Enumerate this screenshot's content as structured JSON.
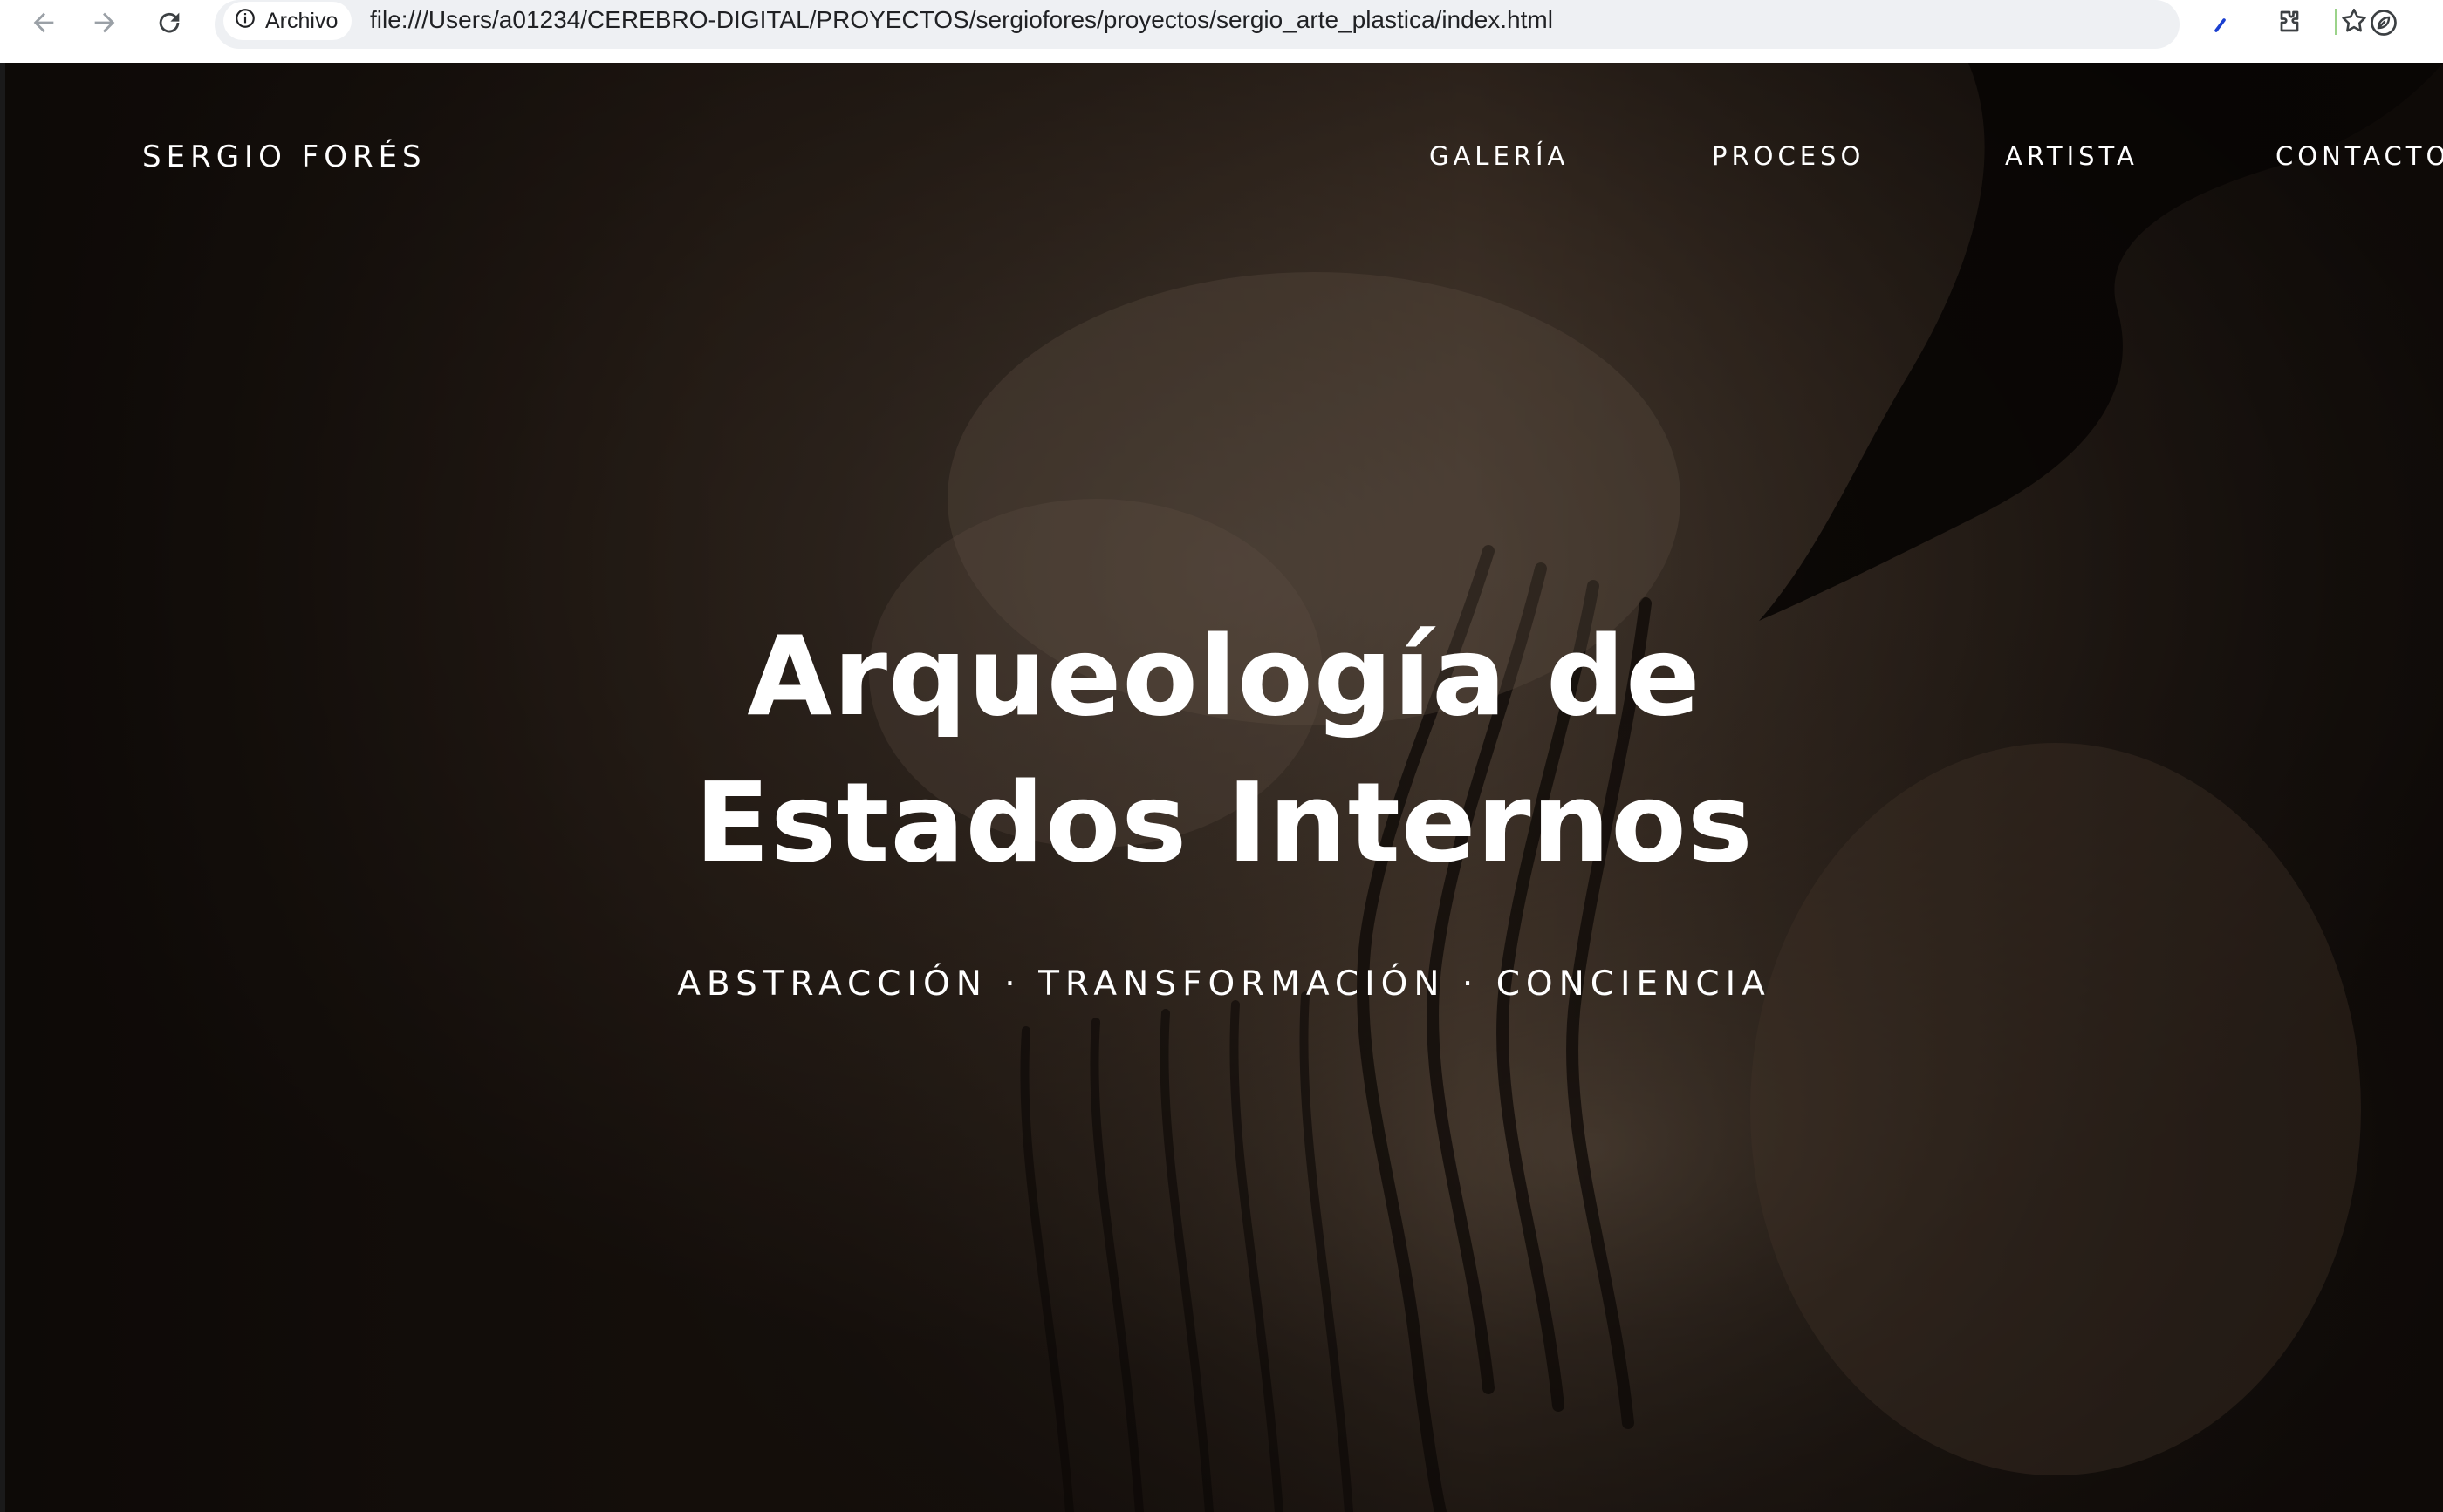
{
  "browser": {
    "site_chip_label": "Archivo",
    "url": "file:///Users/a01234/CEREBRO-DIGITAL/PROYECTOS/sergiofores/proyectos/sergio_arte_plastica/index.html",
    "icons": [
      "back-icon",
      "forward-icon",
      "reload-icon",
      "info-icon",
      "star-icon",
      "extension-pen-icon",
      "puzzle-icon",
      "leaf-icon"
    ]
  },
  "site": {
    "logo": "SERGIO FORÉS",
    "nav": [
      {
        "label": "GALERÍA"
      },
      {
        "label": "PROCESO"
      },
      {
        "label": "ARTISTA"
      },
      {
        "label": "CONTACTO"
      }
    ]
  },
  "hero": {
    "title_line1": "Arqueología de",
    "title_line2": "Estados Internos",
    "subtitle": "ABSTRACCIÓN · TRANSFORMACIÓN · CONCIENCIA"
  },
  "colors": {
    "background": "#2a1f18",
    "text": "#ffffff",
    "chrome": "#eef0f3"
  }
}
